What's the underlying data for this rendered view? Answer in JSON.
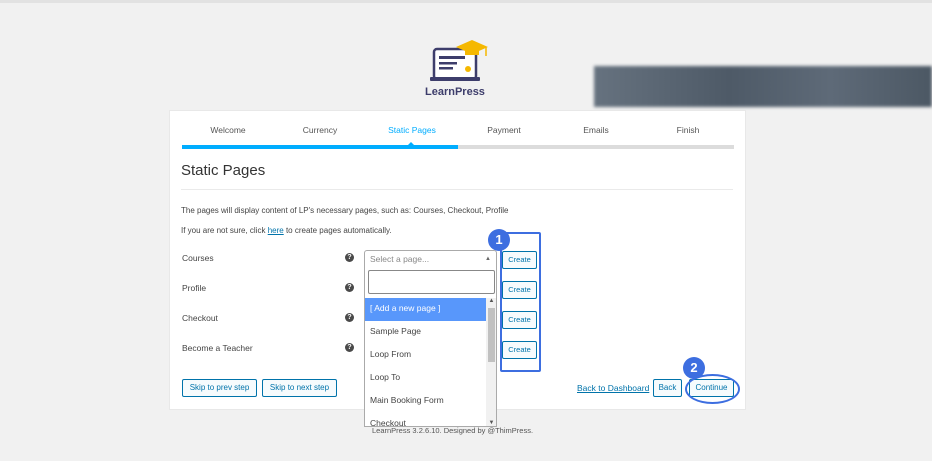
{
  "brand": {
    "name": "LearnPress"
  },
  "steps": [
    {
      "label": "Welcome",
      "active": false
    },
    {
      "label": "Currency",
      "active": false
    },
    {
      "label": "Static Pages",
      "active": true
    },
    {
      "label": "Payment",
      "active": false
    },
    {
      "label": "Emails",
      "active": false
    },
    {
      "label": "Finish",
      "active": false
    }
  ],
  "page": {
    "title": "Static Pages",
    "description": "The pages will display content of LP's necessary pages, such as: Courses, Checkout, Profile",
    "hint_prefix": "If you are not sure, click ",
    "hint_link": "here",
    "hint_suffix": " to create pages automatically."
  },
  "rows": [
    {
      "label": "Courses",
      "help": "?",
      "create": "Create"
    },
    {
      "label": "Profile",
      "help": "?",
      "create": "Create"
    },
    {
      "label": "Checkout",
      "help": "?",
      "create": "Create"
    },
    {
      "label": "Become a Teacher",
      "help": "?",
      "create": "Create"
    }
  ],
  "select": {
    "placeholder": "Select a page...",
    "search_value": "",
    "options": [
      "[ Add a new page ]",
      "Sample Page",
      "Loop From",
      "Loop To",
      "Main Booking Form",
      "Checkout"
    ]
  },
  "buttons": {
    "skip_prev": "Skip to prev step",
    "skip_next": "Skip to next step",
    "back_dashboard": "Back to Dashboard",
    "back": "Back",
    "continue": "Continue"
  },
  "annotations": {
    "one": "1",
    "two": "2"
  },
  "footer": "LearnPress 3.2.6.10. Designed by @ThimPress.",
  "colors": {
    "accent": "#00adff",
    "link": "#0073aa",
    "annotation": "#3d6ee0",
    "highlight": "#5897fb"
  }
}
